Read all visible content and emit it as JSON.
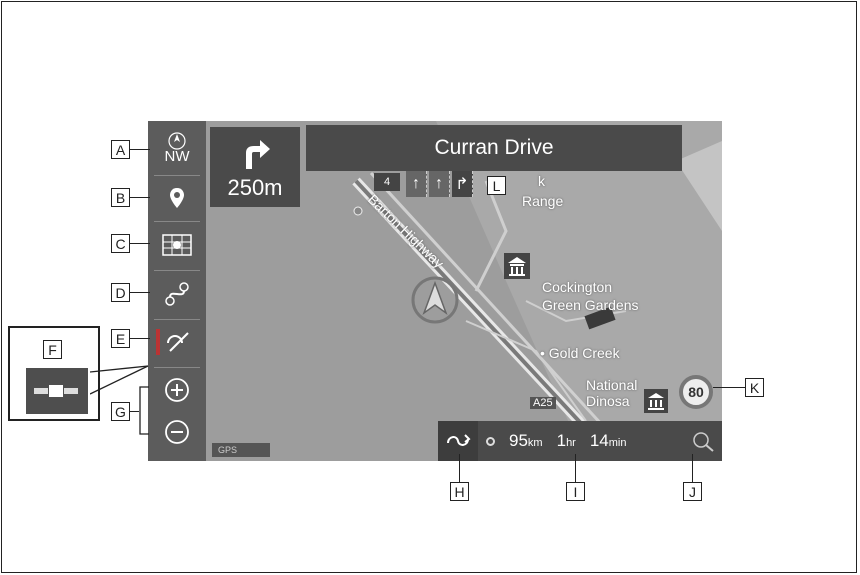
{
  "sidebar": {
    "compass_label": "NW",
    "compass_north": "N"
  },
  "guidance": {
    "distance": "250m",
    "street_name": "Curran Drive",
    "road_number": "4"
  },
  "map": {
    "labels": {
      "road": "Barton Highway",
      "place1": "Cockington",
      "place2": "Green Gardens",
      "place3": "• Gold Creek",
      "place4": "National",
      "place5": "Dinosa",
      "place6": "k",
      "place7": "Range",
      "route": "A25"
    },
    "speed_limit": "80",
    "gps_label": "GPS"
  },
  "eta_bar": {
    "distance_value": "95",
    "distance_unit": "km",
    "hours_value": "1",
    "hours_unit": "hr",
    "minutes_value": "14",
    "minutes_unit": "min"
  },
  "callouts": {
    "a": "A",
    "b": "B",
    "c": "C",
    "d": "D",
    "e": "E",
    "f": "F",
    "g": "G",
    "h": "H",
    "i": "I",
    "j": "J",
    "k": "K",
    "l": "L"
  },
  "colors": {
    "panel": "#4a4a4a",
    "map_bg": "#9b9b9b",
    "sidebar": "#5c5c5c"
  }
}
